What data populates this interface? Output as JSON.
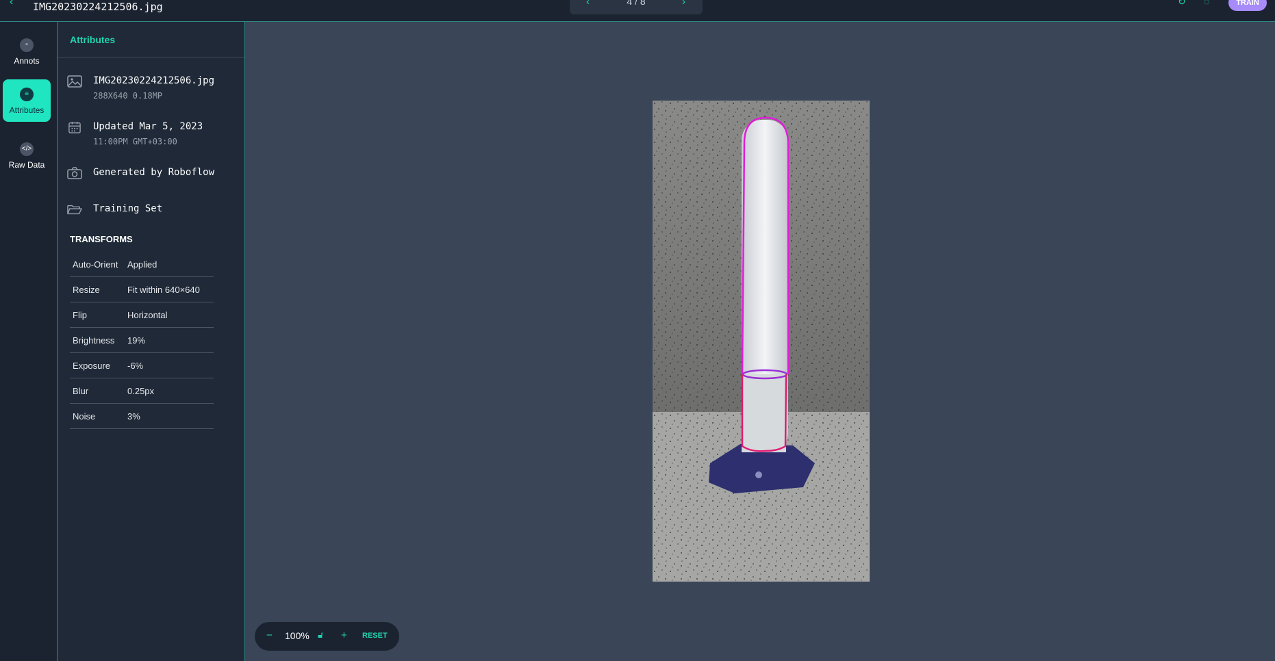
{
  "topbar": {
    "filename": "IMG20230224212506.jpg",
    "pager": "4 / 8",
    "train_label": "TRAIN"
  },
  "rail": {
    "items": [
      {
        "label": "Annots",
        "icon": "annotation-icon"
      },
      {
        "label": "Attributes",
        "icon": "list-icon"
      },
      {
        "label": "Raw Data",
        "icon": "code-icon"
      }
    ]
  },
  "panel": {
    "title": "Attributes",
    "file": {
      "name": "IMG20230224212506.jpg",
      "details": "288X640  0.18MP"
    },
    "updated": {
      "line1": "Updated Mar 5, 2023",
      "line2": "11:00PM  GMT+03:00"
    },
    "generated": "Generated by Roboflow",
    "split": "Training Set",
    "transforms_title": "TRANSFORMS",
    "transforms": [
      {
        "key": "Auto-Orient",
        "value": "Applied"
      },
      {
        "key": "Resize",
        "value": "Fit within 640×640"
      },
      {
        "key": "Flip",
        "value": "Horizontal"
      },
      {
        "key": "Brightness",
        "value": "19%"
      },
      {
        "key": "Exposure",
        "value": "-6%"
      },
      {
        "key": "Blur",
        "value": "0.25px"
      },
      {
        "key": "Noise",
        "value": "3%"
      }
    ]
  },
  "zoom": {
    "value": "100%",
    "reset_label": "RESET"
  },
  "colors": {
    "accent": "#22d3b0",
    "annotation_magenta": "#e11dd8",
    "annotation_pink": "#e11d74"
  }
}
